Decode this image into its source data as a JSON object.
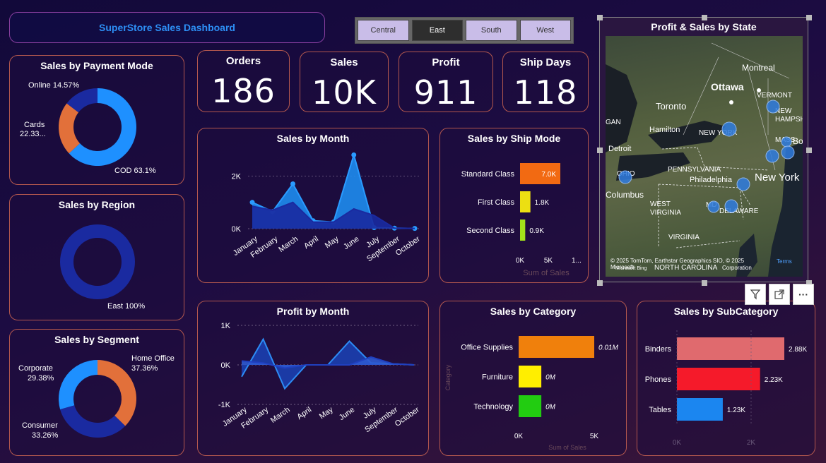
{
  "title": "SuperStore Sales Dashboard",
  "slicer": [
    "Central",
    "East",
    "South",
    "West"
  ],
  "slicer_active": "East",
  "kpis": [
    {
      "label": "Orders",
      "value": "186"
    },
    {
      "label": "Sales",
      "value": "10K"
    },
    {
      "label": "Profit",
      "value": "911"
    },
    {
      "label": "Ship Days",
      "value": "118"
    }
  ],
  "payment": {
    "title": "Sales by Payment Mode",
    "online": "Online 14.57%",
    "cards_1": "Cards",
    "cards_2": "22.33...",
    "cod": "COD 63.1%"
  },
  "region": {
    "title": "Sales by Region",
    "east": "East 100%"
  },
  "segment": {
    "title": "Sales by Segment",
    "corporate_1": "Corporate",
    "corporate_2": "29.38%",
    "home_1": "Home Office",
    "home_2": "37.36%",
    "consumer_1": "Consumer",
    "consumer_2": "33.26%"
  },
  "sales_month": {
    "title": "Sales by Month",
    "yticks": [
      "2K",
      "0K"
    ],
    "months": [
      "January",
      "February",
      "March",
      "April",
      "May",
      "June",
      "July",
      "September",
      "October"
    ]
  },
  "profit_month": {
    "title": "Profit by Month",
    "yticks": [
      "1K",
      "0K",
      "-1K"
    ],
    "months": [
      "January",
      "February",
      "March",
      "April",
      "May",
      "June",
      "July",
      "September",
      "October"
    ]
  },
  "ship_mode": {
    "title": "Sales by Ship Mode",
    "categories": [
      "Standard Class",
      "First Class",
      "Second Class"
    ],
    "values_labels": [
      "7.0K",
      "1.8K",
      "0.9K"
    ],
    "xticks": [
      "0K",
      "5K",
      "1..."
    ],
    "xlabel": "Sum of Sales"
  },
  "category": {
    "title": "Sales by Category",
    "categories": [
      "Office Supplies",
      "Furniture",
      "Technology"
    ],
    "values_labels": [
      "0.01M",
      "0M",
      "0M"
    ],
    "xticks": [
      "0K",
      "5K"
    ],
    "xlabel": "Sum of Sales",
    "ylabel": "Category"
  },
  "subcategory": {
    "title": "Sales by SubCategory",
    "categories": [
      "Binders",
      "Phones",
      "Tables"
    ],
    "values_labels": [
      "2.88K",
      "2.23K",
      "1.23K"
    ],
    "xticks": [
      "0K",
      "2K"
    ]
  },
  "map": {
    "title": "Profit & Sales by State",
    "places": [
      "Montreal",
      "Ottawa",
      "VERMONT",
      "NEW HAMPSHIRE",
      "Toronto",
      "Hamilton",
      "NEW YORK",
      "Detroit",
      "PENNSYLVANIA",
      "Philadelphia",
      "New York",
      "OHIO",
      "Columbus",
      "WEST VIRGINIA",
      "MD",
      "DELAWARE",
      "VIRGINIA",
      "NORTH CAROLINA",
      "MASS.",
      "Bo",
      "GAN"
    ],
    "copyright_1": "© 2025 TomTom, Earthstar Geographics SIO, © 2025 Microsoft",
    "copyright_2": "Corporation",
    "terms": "Terms",
    "bing": "Microsoft Bing"
  },
  "chart_data": [
    {
      "type": "pie",
      "title": "Sales by Payment Mode",
      "categories": [
        "COD",
        "Cards",
        "Online"
      ],
      "values": [
        63.1,
        22.33,
        14.57
      ],
      "colors": [
        "#1e90ff",
        "#e2703a",
        "#1a2aa0"
      ]
    },
    {
      "type": "pie",
      "title": "Sales by Region",
      "categories": [
        "East"
      ],
      "values": [
        100
      ],
      "colors": [
        "#1a2aa0"
      ]
    },
    {
      "type": "pie",
      "title": "Sales by Segment",
      "categories": [
        "Home Office",
        "Consumer",
        "Corporate"
      ],
      "values": [
        37.36,
        33.26,
        29.38
      ],
      "colors": [
        "#e2703a",
        "#1a2aa0",
        "#1e90ff"
      ]
    },
    {
      "type": "area",
      "title": "Sales by Month",
      "categories": [
        "January",
        "February",
        "March",
        "April",
        "May",
        "June",
        "July",
        "September",
        "October"
      ],
      "series": [
        {
          "name": "Sales",
          "values": [
            1000,
            650,
            1700,
            300,
            250,
            2800,
            40,
            20,
            10
          ]
        },
        {
          "values": [
            850,
            700,
            1000,
            250,
            250,
            750,
            500,
            20,
            10
          ]
        }
      ],
      "ylim": [
        0,
        3000
      ]
    },
    {
      "type": "area",
      "title": "Profit by Month",
      "categories": [
        "January",
        "February",
        "March",
        "April",
        "May",
        "June",
        "July",
        "September",
        "October"
      ],
      "series": [
        {
          "name": "Profit",
          "values": [
            -300,
            650,
            -600,
            0,
            0,
            600,
            50,
            30,
            0
          ]
        },
        {
          "values": [
            100,
            50,
            -80,
            0,
            0,
            0,
            200,
            30,
            0
          ]
        }
      ],
      "ylim": [
        -1000,
        1000
      ]
    },
    {
      "type": "bar",
      "title": "Sales by Ship Mode",
      "categories": [
        "Standard Class",
        "First Class",
        "Second Class"
      ],
      "values": [
        7000,
        1800,
        900
      ],
      "colors": [
        "#f26a12",
        "#ecdf12",
        "#a3e21a"
      ],
      "xlabel": "Sum of Sales"
    },
    {
      "type": "bar",
      "title": "Sales by Category",
      "categories": [
        "Office Supplies",
        "Furniture",
        "Technology"
      ],
      "values": [
        10000,
        3000,
        3000
      ],
      "colors": [
        "#f0800c",
        "#ffee00",
        "#22cc11"
      ],
      "xlabel": "Sum of Sales",
      "ylabel": "Category"
    },
    {
      "type": "bar",
      "title": "Sales by SubCategory",
      "categories": [
        "Binders",
        "Phones",
        "Tables"
      ],
      "values": [
        2880,
        2230,
        1230
      ],
      "colors": [
        "#e06a6e",
        "#f51a2a",
        "#1b86f0"
      ]
    }
  ]
}
